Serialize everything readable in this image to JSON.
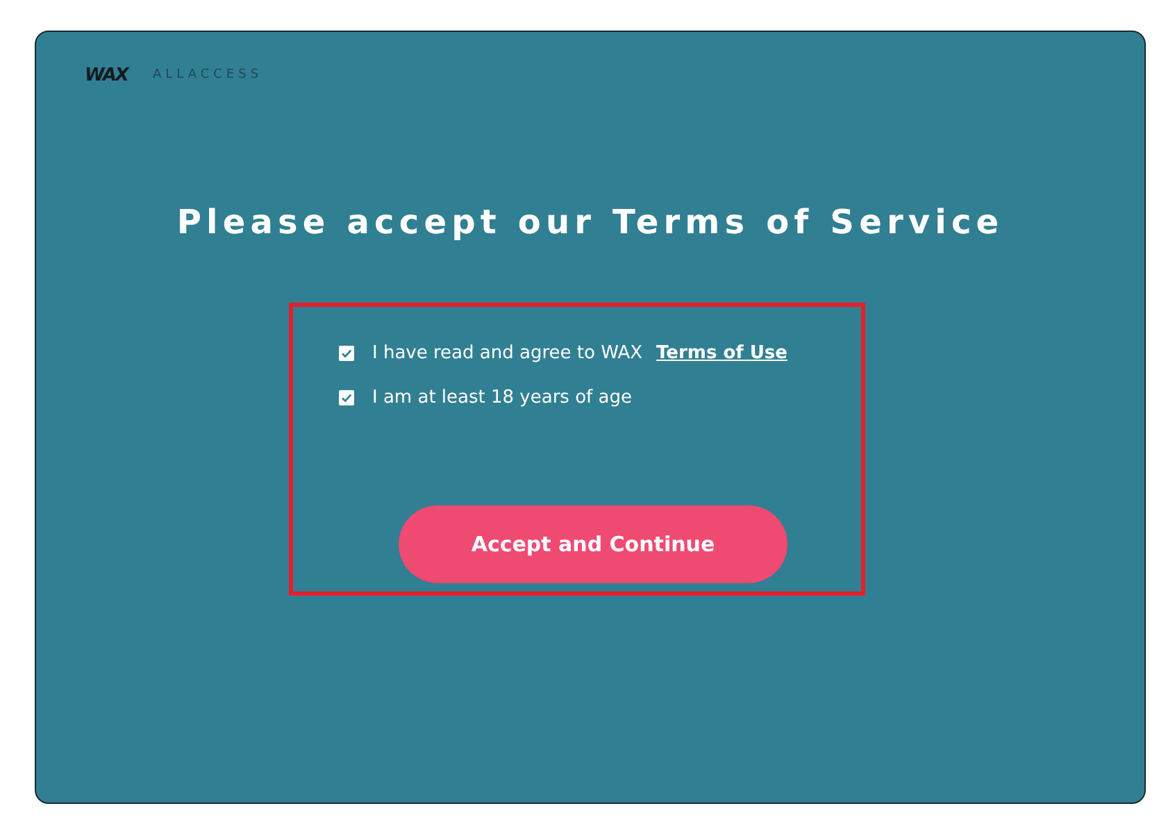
{
  "brand": {
    "logo": "WAX",
    "product": "ALLACCESS"
  },
  "title": "Please accept our Terms of Service",
  "agreements": [
    {
      "text": "I have read and agree to WAX",
      "link": "Terms of Use",
      "checked": true
    },
    {
      "text": "I am at least 18 years of age",
      "checked": true
    }
  ],
  "button": "Accept and Continue"
}
